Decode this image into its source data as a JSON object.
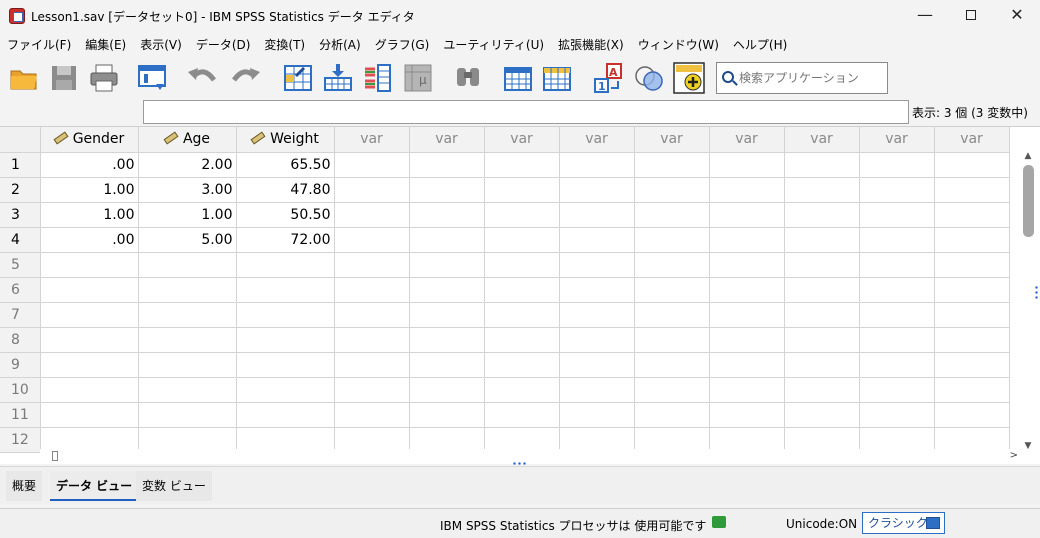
{
  "window": {
    "title": "Lesson1.sav [データセット0] - IBM SPSS Statistics データ エディタ",
    "minimize": "—",
    "maximize": "",
    "close": "✕"
  },
  "menu": [
    "ファイル(F)",
    "編集(E)",
    "表示(V)",
    "データ(D)",
    "変換(T)",
    "分析(A)",
    "グラフ(G)",
    "ユーティリティ(U)",
    "拡張機能(X)",
    "ウィンドウ(W)",
    "ヘルプ(H)"
  ],
  "toolbar": {
    "icons": [
      "open-folder-icon",
      "save-icon",
      "print-icon",
      "recall-dialog-icon",
      "undo-icon",
      "redo-icon",
      "goto-case-icon",
      "goto-variable-icon",
      "variables-icon",
      "run-descriptives-icon",
      "find-icon",
      "insert-cases-icon",
      "insert-variable-icon",
      "value-labels-icon",
      "use-sets-icon",
      "spelling-icon"
    ],
    "search_placeholder": "検索アプリケーション"
  },
  "editor": {
    "visible_count": "表示: 3 個 (3 変数中)"
  },
  "grid": {
    "columns": [
      "Gender",
      "Age",
      "Weight",
      "var",
      "var",
      "var",
      "var",
      "var",
      "var",
      "var",
      "var",
      "var"
    ],
    "rows": [
      {
        "num": "1",
        "values": [
          ".00",
          "2.00",
          "65.50"
        ]
      },
      {
        "num": "2",
        "values": [
          "1.00",
          "3.00",
          "47.80"
        ]
      },
      {
        "num": "3",
        "values": [
          "1.00",
          "1.00",
          "50.50"
        ]
      },
      {
        "num": "4",
        "values": [
          ".00",
          "5.00",
          "72.00"
        ]
      },
      {
        "num": "5",
        "values": []
      },
      {
        "num": "6",
        "values": []
      },
      {
        "num": "7",
        "values": []
      },
      {
        "num": "8",
        "values": []
      },
      {
        "num": "9",
        "values": []
      },
      {
        "num": "10",
        "values": []
      },
      {
        "num": "11",
        "values": []
      },
      {
        "num": "12",
        "values": []
      }
    ]
  },
  "tabs": [
    "概要",
    "データ ビュー",
    "変数 ビュー"
  ],
  "status": {
    "processor": "IBM SPSS Statistics プロセッサは 使用可能です",
    "unicode": "Unicode:ON",
    "mode": "クラシック"
  },
  "colors": {
    "accent": "#1f5fbf",
    "var_header": "#8a8a8a"
  }
}
